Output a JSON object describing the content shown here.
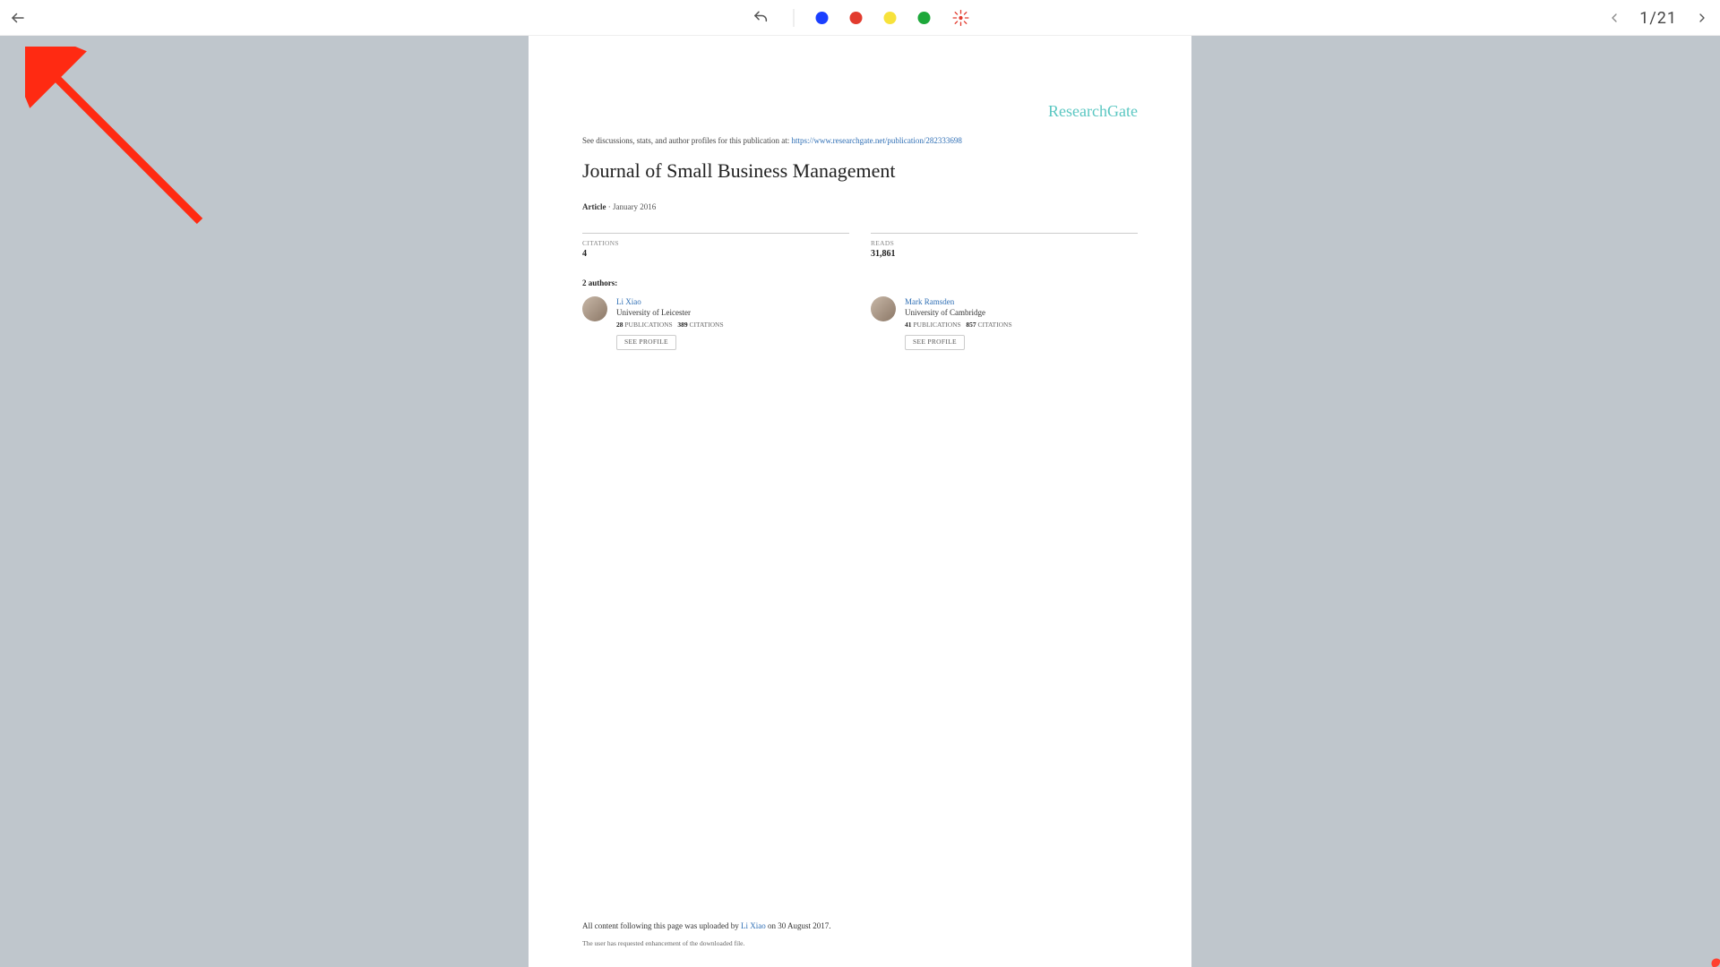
{
  "toolbar": {
    "colors": {
      "blue": "#1a3fff",
      "red": "#e23b2e",
      "yellow": "#f7e23b",
      "green": "#1da83a"
    },
    "page_counter": "1/21"
  },
  "document": {
    "brand": "ResearchGate",
    "meta_top_prefix": "See discussions, stats, and author profiles for this publication at: ",
    "meta_top_link": "https://www.researchgate.net/publication/282333698",
    "title": "Journal of Small Business Management",
    "type": "Article",
    "date": "January 2016",
    "citations_label": "CITATIONS",
    "citations_value": "4",
    "reads_label": "READS",
    "reads_value": "31,861",
    "authors_count_label": "2 authors:",
    "authors": [
      {
        "name": "Li Xiao",
        "affiliation": "University of Leicester",
        "pubs": "28",
        "pubs_label": "PUBLICATIONS",
        "cites": "389",
        "cites_label": "CITATIONS",
        "see_profile": "SEE PROFILE"
      },
      {
        "name": "Mark Ramsden",
        "affiliation": "University of Cambridge",
        "pubs": "41",
        "pubs_label": "PUBLICATIONS",
        "cites": "857",
        "cites_label": "CITATIONS",
        "see_profile": "SEE PROFILE"
      }
    ],
    "footer_prefix": "All content following this page was uploaded by ",
    "footer_uploader": "Li Xiao",
    "footer_suffix": " on 30 August 2017.",
    "footer_note": "The user has requested enhancement of the downloaded file."
  }
}
